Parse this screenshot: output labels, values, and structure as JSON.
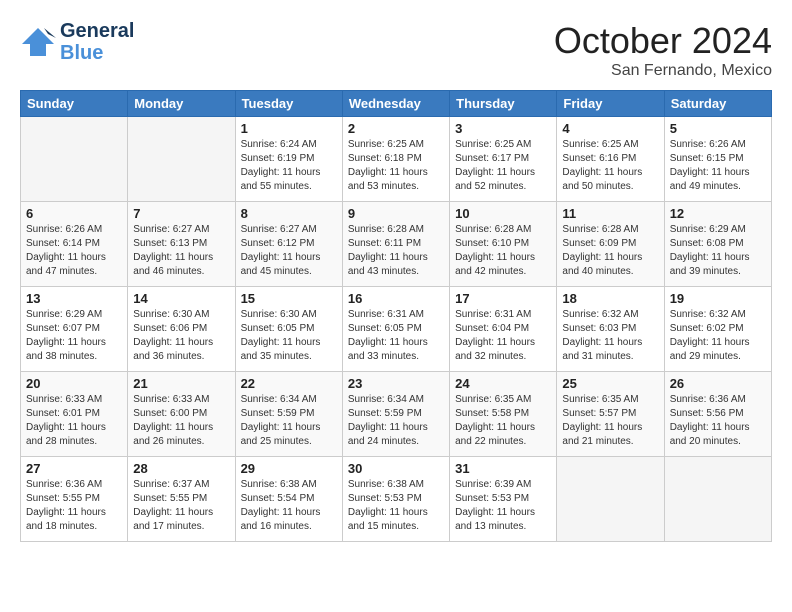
{
  "header": {
    "logo_general": "General",
    "logo_blue": "Blue",
    "month_title": "October 2024",
    "location": "San Fernando, Mexico"
  },
  "days_of_week": [
    "Sunday",
    "Monday",
    "Tuesday",
    "Wednesday",
    "Thursday",
    "Friday",
    "Saturday"
  ],
  "weeks": [
    [
      {
        "day": "",
        "empty": true
      },
      {
        "day": "",
        "empty": true
      },
      {
        "day": "1",
        "sunrise": "Sunrise: 6:24 AM",
        "sunset": "Sunset: 6:19 PM",
        "daylight": "Daylight: 11 hours and 55 minutes."
      },
      {
        "day": "2",
        "sunrise": "Sunrise: 6:25 AM",
        "sunset": "Sunset: 6:18 PM",
        "daylight": "Daylight: 11 hours and 53 minutes."
      },
      {
        "day": "3",
        "sunrise": "Sunrise: 6:25 AM",
        "sunset": "Sunset: 6:17 PM",
        "daylight": "Daylight: 11 hours and 52 minutes."
      },
      {
        "day": "4",
        "sunrise": "Sunrise: 6:25 AM",
        "sunset": "Sunset: 6:16 PM",
        "daylight": "Daylight: 11 hours and 50 minutes."
      },
      {
        "day": "5",
        "sunrise": "Sunrise: 6:26 AM",
        "sunset": "Sunset: 6:15 PM",
        "daylight": "Daylight: 11 hours and 49 minutes."
      }
    ],
    [
      {
        "day": "6",
        "sunrise": "Sunrise: 6:26 AM",
        "sunset": "Sunset: 6:14 PM",
        "daylight": "Daylight: 11 hours and 47 minutes."
      },
      {
        "day": "7",
        "sunrise": "Sunrise: 6:27 AM",
        "sunset": "Sunset: 6:13 PM",
        "daylight": "Daylight: 11 hours and 46 minutes."
      },
      {
        "day": "8",
        "sunrise": "Sunrise: 6:27 AM",
        "sunset": "Sunset: 6:12 PM",
        "daylight": "Daylight: 11 hours and 45 minutes."
      },
      {
        "day": "9",
        "sunrise": "Sunrise: 6:28 AM",
        "sunset": "Sunset: 6:11 PM",
        "daylight": "Daylight: 11 hours and 43 minutes."
      },
      {
        "day": "10",
        "sunrise": "Sunrise: 6:28 AM",
        "sunset": "Sunset: 6:10 PM",
        "daylight": "Daylight: 11 hours and 42 minutes."
      },
      {
        "day": "11",
        "sunrise": "Sunrise: 6:28 AM",
        "sunset": "Sunset: 6:09 PM",
        "daylight": "Daylight: 11 hours and 40 minutes."
      },
      {
        "day": "12",
        "sunrise": "Sunrise: 6:29 AM",
        "sunset": "Sunset: 6:08 PM",
        "daylight": "Daylight: 11 hours and 39 minutes."
      }
    ],
    [
      {
        "day": "13",
        "sunrise": "Sunrise: 6:29 AM",
        "sunset": "Sunset: 6:07 PM",
        "daylight": "Daylight: 11 hours and 38 minutes."
      },
      {
        "day": "14",
        "sunrise": "Sunrise: 6:30 AM",
        "sunset": "Sunset: 6:06 PM",
        "daylight": "Daylight: 11 hours and 36 minutes."
      },
      {
        "day": "15",
        "sunrise": "Sunrise: 6:30 AM",
        "sunset": "Sunset: 6:05 PM",
        "daylight": "Daylight: 11 hours and 35 minutes."
      },
      {
        "day": "16",
        "sunrise": "Sunrise: 6:31 AM",
        "sunset": "Sunset: 6:05 PM",
        "daylight": "Daylight: 11 hours and 33 minutes."
      },
      {
        "day": "17",
        "sunrise": "Sunrise: 6:31 AM",
        "sunset": "Sunset: 6:04 PM",
        "daylight": "Daylight: 11 hours and 32 minutes."
      },
      {
        "day": "18",
        "sunrise": "Sunrise: 6:32 AM",
        "sunset": "Sunset: 6:03 PM",
        "daylight": "Daylight: 11 hours and 31 minutes."
      },
      {
        "day": "19",
        "sunrise": "Sunrise: 6:32 AM",
        "sunset": "Sunset: 6:02 PM",
        "daylight": "Daylight: 11 hours and 29 minutes."
      }
    ],
    [
      {
        "day": "20",
        "sunrise": "Sunrise: 6:33 AM",
        "sunset": "Sunset: 6:01 PM",
        "daylight": "Daylight: 11 hours and 28 minutes."
      },
      {
        "day": "21",
        "sunrise": "Sunrise: 6:33 AM",
        "sunset": "Sunset: 6:00 PM",
        "daylight": "Daylight: 11 hours and 26 minutes."
      },
      {
        "day": "22",
        "sunrise": "Sunrise: 6:34 AM",
        "sunset": "Sunset: 5:59 PM",
        "daylight": "Daylight: 11 hours and 25 minutes."
      },
      {
        "day": "23",
        "sunrise": "Sunrise: 6:34 AM",
        "sunset": "Sunset: 5:59 PM",
        "daylight": "Daylight: 11 hours and 24 minutes."
      },
      {
        "day": "24",
        "sunrise": "Sunrise: 6:35 AM",
        "sunset": "Sunset: 5:58 PM",
        "daylight": "Daylight: 11 hours and 22 minutes."
      },
      {
        "day": "25",
        "sunrise": "Sunrise: 6:35 AM",
        "sunset": "Sunset: 5:57 PM",
        "daylight": "Daylight: 11 hours and 21 minutes."
      },
      {
        "day": "26",
        "sunrise": "Sunrise: 6:36 AM",
        "sunset": "Sunset: 5:56 PM",
        "daylight": "Daylight: 11 hours and 20 minutes."
      }
    ],
    [
      {
        "day": "27",
        "sunrise": "Sunrise: 6:36 AM",
        "sunset": "Sunset: 5:55 PM",
        "daylight": "Daylight: 11 hours and 18 minutes."
      },
      {
        "day": "28",
        "sunrise": "Sunrise: 6:37 AM",
        "sunset": "Sunset: 5:55 PM",
        "daylight": "Daylight: 11 hours and 17 minutes."
      },
      {
        "day": "29",
        "sunrise": "Sunrise: 6:38 AM",
        "sunset": "Sunset: 5:54 PM",
        "daylight": "Daylight: 11 hours and 16 minutes."
      },
      {
        "day": "30",
        "sunrise": "Sunrise: 6:38 AM",
        "sunset": "Sunset: 5:53 PM",
        "daylight": "Daylight: 11 hours and 15 minutes."
      },
      {
        "day": "31",
        "sunrise": "Sunrise: 6:39 AM",
        "sunset": "Sunset: 5:53 PM",
        "daylight": "Daylight: 11 hours and 13 minutes."
      },
      {
        "day": "",
        "empty": true
      },
      {
        "day": "",
        "empty": true
      }
    ]
  ]
}
